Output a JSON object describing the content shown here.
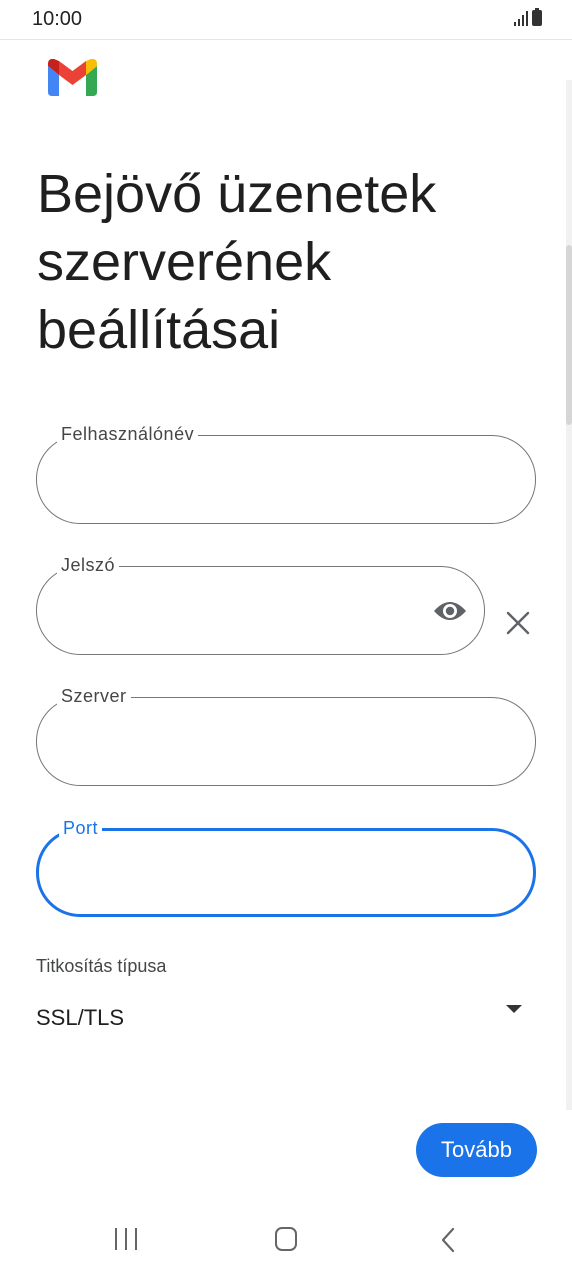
{
  "status_bar": {
    "time": "10:00"
  },
  "header": {
    "title": "Bejövő üzenetek szerverének beállításai"
  },
  "form": {
    "username_label": "Felhasználónév",
    "username_value": "",
    "password_label": "Jelszó",
    "password_value": "",
    "server_label": "Szerver",
    "server_value": "",
    "port_label": "Port",
    "port_value": "",
    "encryption_label": "Titkosítás típusa",
    "encryption_value": "SSL/TLS"
  },
  "actions": {
    "next_label": "Tovább"
  },
  "colors": {
    "accent": "#1a73e8",
    "outline": "#747775",
    "text": "#1f1f1f"
  },
  "icons": {
    "logo": "gmail-logo",
    "show_password": "eye-icon",
    "clear": "close-icon",
    "dropdown": "dropdown-arrow-icon",
    "nav_recent": "recent-apps-icon",
    "nav_home": "home-icon",
    "nav_back": "back-icon"
  }
}
